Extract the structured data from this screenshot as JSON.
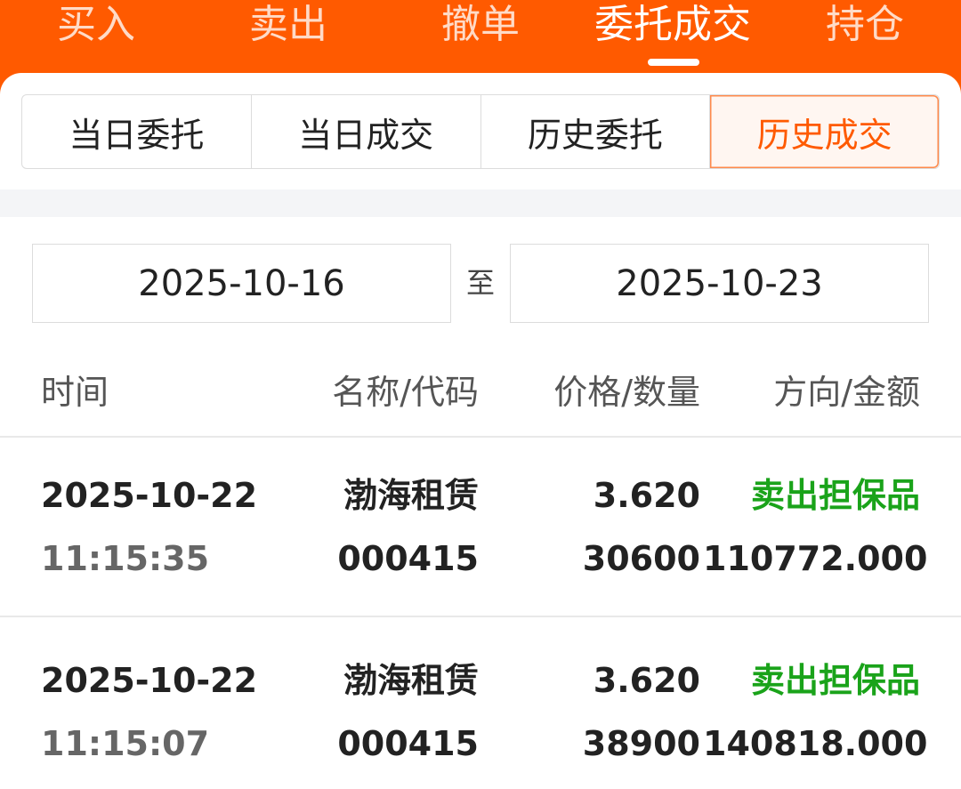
{
  "tabs": [
    {
      "label": "买入"
    },
    {
      "label": "卖出"
    },
    {
      "label": "撤单"
    },
    {
      "label": "委托成交",
      "active": true
    },
    {
      "label": "持仓"
    }
  ],
  "segments": [
    {
      "label": "当日委托"
    },
    {
      "label": "当日成交"
    },
    {
      "label": "历史委托"
    },
    {
      "label": "历史成交",
      "active": true
    }
  ],
  "date_range": {
    "start": "2025-10-16",
    "separator": "至",
    "end": "2025-10-23"
  },
  "table": {
    "headers": [
      "时间",
      "名称/代码",
      "价格/数量",
      "方向/金额"
    ],
    "rows": [
      {
        "date": "2025-10-22",
        "time": "11:15:35",
        "name": "渤海租赁",
        "code": "000415",
        "price": "3.620",
        "quantity": "30600",
        "direction": "卖出担保品",
        "amount": "110772.000"
      },
      {
        "date": "2025-10-22",
        "time": "11:15:07",
        "name": "渤海租赁",
        "code": "000415",
        "price": "3.620",
        "quantity": "38900",
        "direction": "卖出担保品",
        "amount": "140818.000"
      }
    ]
  },
  "colors": {
    "accent": "#ff5a00",
    "sell_direction": "#1aa31a"
  }
}
